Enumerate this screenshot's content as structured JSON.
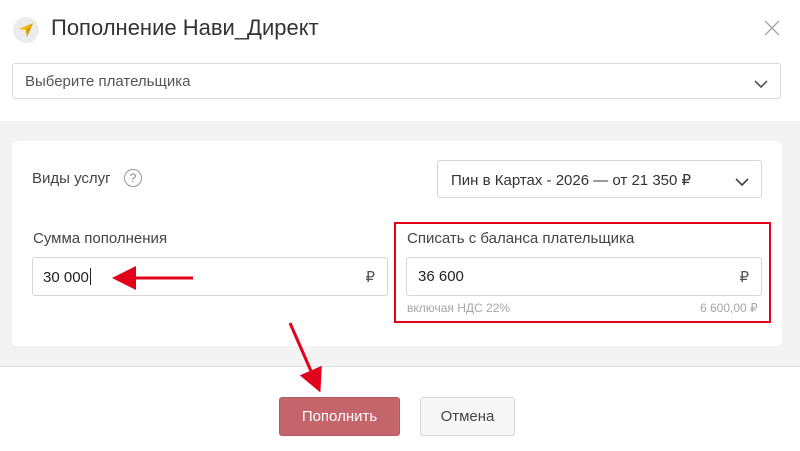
{
  "dialog": {
    "title": "Пополнение Нави_Директ",
    "payer_placeholder": "Выберите плательщика"
  },
  "services": {
    "label": "Виды услуг",
    "help": "?",
    "selected": "Пин в Картах - 2026 — от 21 350 ₽"
  },
  "topup": {
    "label": "Сумма пополнения",
    "value": "30 000",
    "currency": "₽"
  },
  "debit": {
    "label": "Списать с баланса плательщика",
    "value": "36 600",
    "currency": "₽",
    "vat_note": "включая НДС 22%",
    "vat_amount": "6 600,00 ₽"
  },
  "buttons": {
    "submit": "Пополнить",
    "cancel": "Отмена"
  },
  "colors": {
    "accent": "#c4656c",
    "annotation": "#e3001b"
  },
  "icons": {
    "logo": "navigation-arrow-icon",
    "close": "close-icon",
    "help": "question-icon",
    "dropdown": "chevron-down-icon"
  }
}
